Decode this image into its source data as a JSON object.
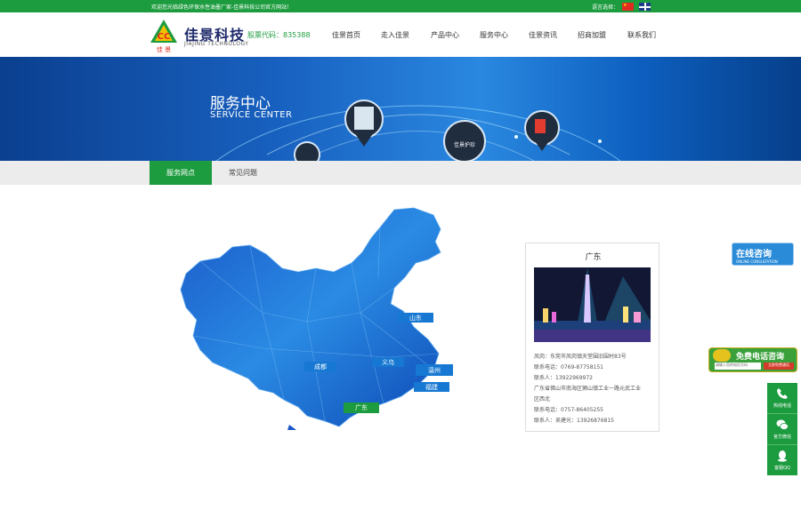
{
  "topbar": {
    "welcome": "欢迎您光临绿色环保水性油墨厂家-佳景科技公司官方网站！",
    "language_label": "语言选择："
  },
  "header": {
    "brand_cn": "佳景科技",
    "brand_en": "JIAJING TECHNOLOGY",
    "logo_letters": "CC",
    "logo_cn": "佳 景",
    "stock": "股票代码：835388",
    "nav": [
      "佳景首页",
      "走入佳景",
      "产品中心",
      "服务中心",
      "佳景资讯",
      "招商加盟",
      "联系我们"
    ]
  },
  "banner": {
    "title": "服务中心",
    "subtitle": "SERVICE CENTER",
    "pin_label": "佳景护珍"
  },
  "subnav": {
    "tabs": [
      {
        "label": "服务网点",
        "active": true
      },
      {
        "label": "常见问题",
        "active": false
      }
    ]
  },
  "map": {
    "labels": [
      "山东",
      "成都",
      "义乌",
      "温州",
      "福建",
      "广东"
    ]
  },
  "card": {
    "title": "广东",
    "lines": [
      "凤岗：东莞市凤岗镇天堂围旧围村83号",
      "联系电话：0769-87758151",
      "联系人：13922969972",
      "广东省佛山市南海区狮山镇工业一路元武工业",
      "区西北",
      "联系电话：0757-86405255",
      "联系人：吴建光：13926876815"
    ]
  },
  "float": {
    "online_title": "在线咨询",
    "online_sub": "ONLINE CONSULTATION",
    "phone_title": "免费电话咨询",
    "phone_placeholder": "请输入您的电话号码",
    "phone_button": "立即免费通话"
  },
  "sidebar": [
    {
      "label": "热线电话",
      "icon": "phone-icon"
    },
    {
      "label": "官方微信",
      "icon": "wechat-icon"
    },
    {
      "label": "客服QQ",
      "icon": "qq-icon"
    }
  ],
  "colors": {
    "brand_green": "#1d9c3f",
    "banner_blue": "#1861c0",
    "map_blue": "#1b6fd1"
  }
}
